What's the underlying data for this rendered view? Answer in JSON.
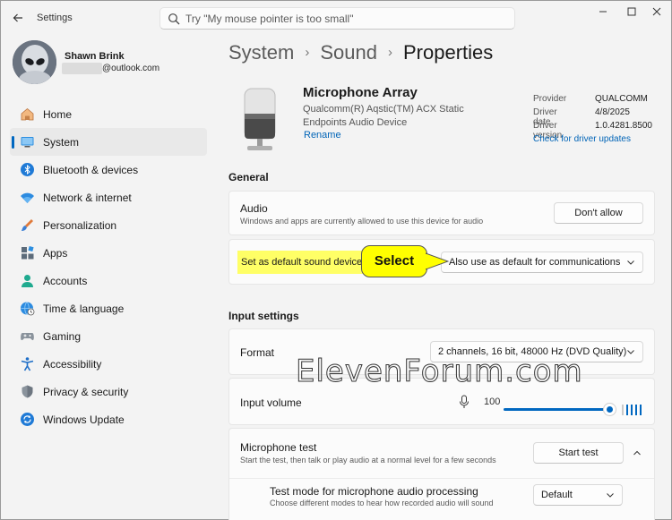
{
  "window": {
    "title": "Settings"
  },
  "search": {
    "placeholder": "Try \"My mouse pointer is too small\""
  },
  "user": {
    "name": "Shawn Brink",
    "email_suffix": "@outlook.com"
  },
  "nav": [
    {
      "label": "Home",
      "icon": "home-icon"
    },
    {
      "label": "System",
      "icon": "monitor-icon",
      "active": true
    },
    {
      "label": "Bluetooth & devices",
      "icon": "bluetooth-icon"
    },
    {
      "label": "Network & internet",
      "icon": "wifi-icon"
    },
    {
      "label": "Personalization",
      "icon": "brush-icon"
    },
    {
      "label": "Apps",
      "icon": "apps-icon"
    },
    {
      "label": "Accounts",
      "icon": "person-icon"
    },
    {
      "label": "Time & language",
      "icon": "globe-clock-icon"
    },
    {
      "label": "Gaming",
      "icon": "gamepad-icon"
    },
    {
      "label": "Accessibility",
      "icon": "accessibility-icon"
    },
    {
      "label": "Privacy & security",
      "icon": "shield-icon"
    },
    {
      "label": "Windows Update",
      "icon": "update-icon"
    }
  ],
  "breadcrumb": [
    "System",
    "Sound",
    "Properties"
  ],
  "device": {
    "name": "Microphone Array",
    "description": "Qualcomm(R) Aqstic(TM) ACX Static Endpoints Audio Device",
    "rename": "Rename",
    "driver": [
      {
        "key": "Provider",
        "value": "QUALCOMM"
      },
      {
        "key": "Driver date",
        "value": "4/8/2025"
      },
      {
        "key": "Driver version",
        "value": "1.0.4281.8500"
      }
    ],
    "driver_link": "Check for driver updates"
  },
  "general": {
    "title": "General",
    "audio": {
      "title": "Audio",
      "desc": "Windows and apps are currently allowed to use this device for audio",
      "button": "Don't allow"
    },
    "default_device": {
      "label": "Set as default sound device",
      "callout": "Select",
      "dropdown": "Also use as default for communications"
    }
  },
  "input": {
    "title": "Input settings",
    "format": {
      "label": "Format",
      "value": "2 channels, 16 bit, 48000 Hz (DVD Quality)"
    },
    "volume": {
      "label": "Input volume",
      "value": "100",
      "level": 100
    },
    "mic_test": {
      "title": "Microphone test",
      "desc": "Start the test, then talk or play audio at a normal level for a few seconds",
      "button": "Start test"
    },
    "test_mode": {
      "title": "Test mode for microphone audio processing",
      "desc": "Choose different modes to hear how recorded audio will sound",
      "value": "Default"
    }
  },
  "watermark": "ElevenForum.com",
  "colors": {
    "accent": "#0067c0",
    "highlight": "#ffff66",
    "callout": "#ffff00"
  }
}
